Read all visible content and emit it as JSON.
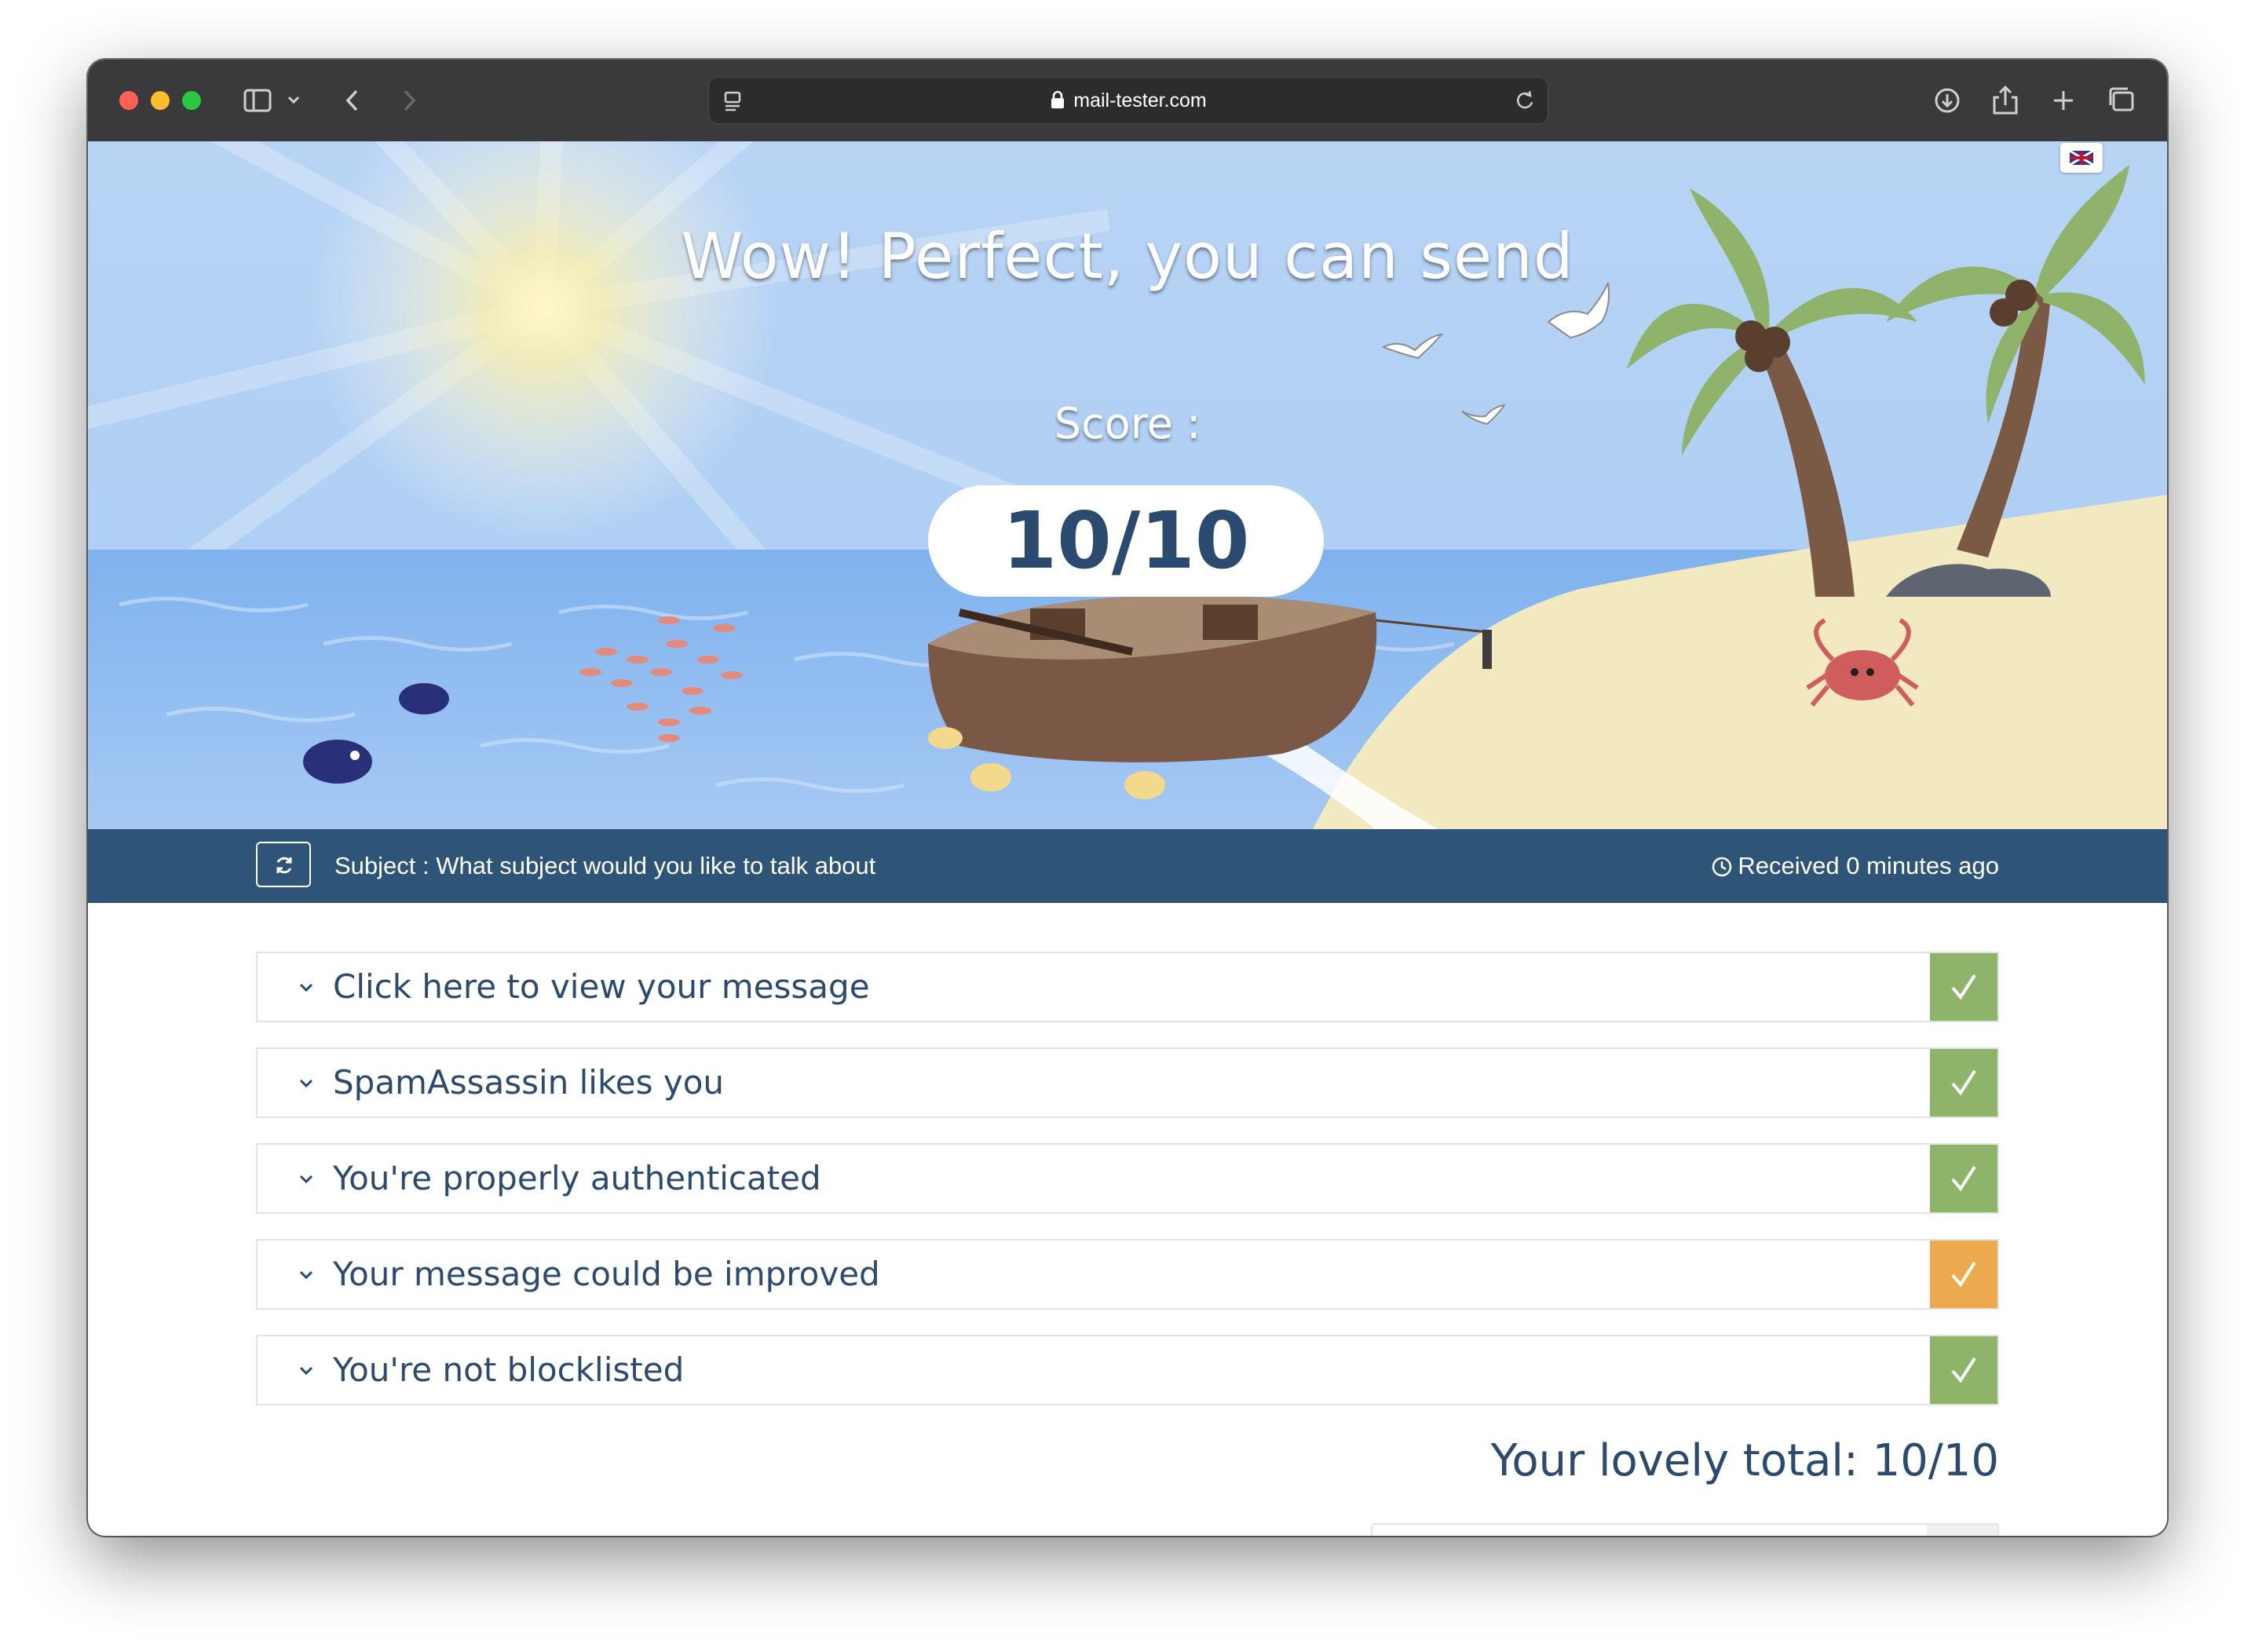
{
  "browser": {
    "url": "mail-tester.com"
  },
  "hero": {
    "title": "Wow! Perfect, you can send",
    "score_label": "Score :",
    "score_value": "10/10"
  },
  "subject_bar": {
    "subject": "Subject : What subject would you like to talk about",
    "received": "Received 0 minutes ago"
  },
  "results": [
    {
      "label": "Click here to view your message",
      "status": "ok",
      "status_color": "#8eb46a"
    },
    {
      "label": "SpamAssassin likes you",
      "status": "ok",
      "status_color": "#8eb46a"
    },
    {
      "label": "You're properly authenticated",
      "status": "ok",
      "status_color": "#8eb46a"
    },
    {
      "label": "Your message could be improved",
      "status": "warn",
      "status_color": "#eda94e"
    },
    {
      "label": "You're not blocklisted",
      "status": "ok",
      "status_color": "#8eb46a"
    }
  ],
  "total": "Your lovely total: 10/10",
  "colors": {
    "accent_dark": "#2e5478",
    "text": "#2b4a6f"
  }
}
